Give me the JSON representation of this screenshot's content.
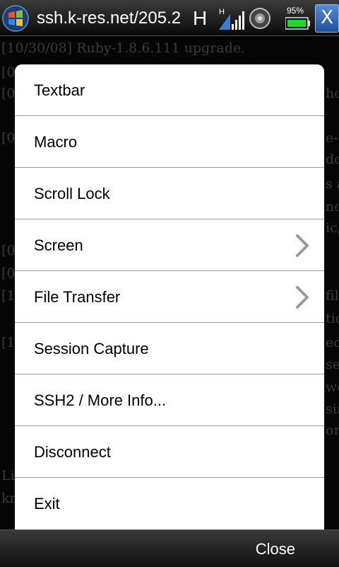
{
  "status_bar": {
    "title": "ssh.k-res.net/205.2",
    "network_letter": "H",
    "signal_letter": "H",
    "battery_percent": "95%",
    "close_symbol": "X"
  },
  "terminal": {
    "lines": [
      "[10/30/08] Ruby-1.8.6.111 upgrade.",
      "[0",
      "[0",
      "ho",
      "[0",
      "e-",
      "do",
      "s a",
      "no",
      "ic/",
      "[0",
      "[0",
      "[1",
      "fill",
      "tic",
      "[1",
      "ed",
      "se",
      "we",
      "sin",
      "ons",
      "Lif",
      "kr"
    ]
  },
  "menu": {
    "items": [
      {
        "label": "Textbar",
        "submenu": false
      },
      {
        "label": "Macro",
        "submenu": false
      },
      {
        "label": "Scroll Lock",
        "submenu": false
      },
      {
        "label": "Screen",
        "submenu": true
      },
      {
        "label": "File Transfer",
        "submenu": true
      },
      {
        "label": "Session Capture",
        "submenu": false
      },
      {
        "label": "SSH2 / More Info...",
        "submenu": false
      },
      {
        "label": "Disconnect",
        "submenu": false
      },
      {
        "label": "Exit",
        "submenu": false
      }
    ]
  },
  "bottom_bar": {
    "close_label": "Close"
  },
  "colors": {
    "menu_background": "#ffffff",
    "divider": "#9a9a9a",
    "chevron": "#999999",
    "battery_green": "#2bd32b"
  }
}
